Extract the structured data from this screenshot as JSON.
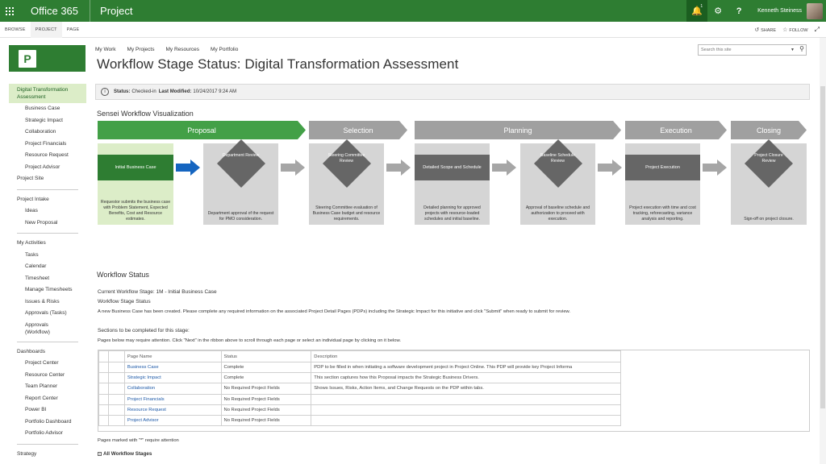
{
  "suite": {
    "brand": "Office 365",
    "app": "Project",
    "notification_count": "1",
    "user_name": "Kenneth Steiness"
  },
  "ribbon": {
    "tabs": [
      "BROWSE",
      "PROJECT",
      "PAGE"
    ],
    "share": "SHARE",
    "follow": "FOLLOW"
  },
  "top_links": [
    "My Work",
    "My Projects",
    "My Resources",
    "My Portfolio"
  ],
  "search": {
    "placeholder": "Search this site"
  },
  "page_title": "Workflow Stage Status: Digital Transformation Assessment",
  "status_bar": {
    "status_label": "Status:",
    "status_value": "Checked-in",
    "modified_label": "Last Modified:",
    "modified_value": "10/24/2017 9:24 AM"
  },
  "left_nav": {
    "project": "Digital Transformation Assessment",
    "project_children": [
      "Business Case",
      "Strategic Impact",
      "Collaboration",
      "Project Financials",
      "Resource Request",
      "Project Advisor"
    ],
    "project_site": "Project Site",
    "intake": "Project Intake",
    "intake_children": [
      "Ideas",
      "New Proposal"
    ],
    "activities": "My Activities",
    "activities_children": [
      "Tasks",
      "Calendar",
      "Timesheet",
      "Manage Timesheets",
      "Issues & Risks",
      "Approvals (Tasks)",
      "Approvals (Workflow)"
    ],
    "dashboards": "Dashboards",
    "dashboards_children": [
      "Project Center",
      "Resource Center",
      "Team Planner",
      "Report Center",
      "Power BI",
      "Portfolio Dashboard",
      "Portfolio Advisor"
    ],
    "strategy": "Strategy"
  },
  "visualization": {
    "title": "Sensei Workflow Visualization",
    "phases": [
      "Proposal",
      "Selection",
      "Planning",
      "Execution",
      "Closing"
    ],
    "steps": [
      {
        "title": "Initial Business Case",
        "desc": "Requestor submits the business case with Problem Statement, Expected Benefits, Cost and Resource estimates."
      },
      {
        "title": "Department Review",
        "desc": "Department approval of the request for PMO consideration."
      },
      {
        "title": "Steering Committee Review",
        "desc": "Steering Committee evaluation of Business Case budget and resource requirements."
      },
      {
        "title": "Detailed Scope and Schedule",
        "desc": "Detailed planning for approved projects with resource-loaded schedules and initial baseline."
      },
      {
        "title": "Baseline Schedule Review",
        "desc": "Approval of baseline schedule and authorization to proceed with execution."
      },
      {
        "title": "Project Execution",
        "desc": "Project execution with time and cost tracking, reforecasting, variance analysis and reporting."
      },
      {
        "title": "Project Closure Review",
        "desc": "Sign-off on project closure."
      }
    ]
  },
  "workflow_status": {
    "title": "Workflow Status",
    "current_stage": "Current Workflow Stage: 1M - Initial Business Case",
    "stage_status_label": "Workflow Stage Status",
    "stage_status_text": "A new Business Case has been created. Please complete any required information on the associated Project Detail Pages (PDPs) including the Strategic Impact for this initiative and click \"Submit\" when ready to submit for review.",
    "sections_label": "Sections to be completed for this stage:",
    "sections_hint": "Pages below may require attention. Click \"Next\" in the ribbon above to scroll through each page or select an individual page by clicking on it below.",
    "table_headers": [
      "Page Name",
      "Status",
      "Description"
    ],
    "table_rows": [
      {
        "page": "Business Case",
        "status": "Complete",
        "desc": "PDP to be filled in when initiating a software development project in Project Online. This PDP will provide key Project Informa"
      },
      {
        "page": "Strategic Impact",
        "status": "Complete",
        "desc": "This section captures how this Proposal impacts the Strategic Business Drivers."
      },
      {
        "page": "Collaboration",
        "status": "No Required Project Fields",
        "desc": "Shows Issues, Risks, Action Items, and Change Requests on the PDP within tabs."
      },
      {
        "page": "Project Financials",
        "status": "No Required Project Fields",
        "desc": ""
      },
      {
        "page": "Resource Request",
        "status": "No Required Project Fields",
        "desc": ""
      },
      {
        "page": "Project Advisor",
        "status": "No Required Project Fields",
        "desc": ""
      }
    ],
    "footer_note": "Pages marked with \"*\" require attention",
    "all_stages": "All Workflow Stages"
  },
  "colors": {
    "brand_green": "#2e7d32",
    "phase_active": "#43a047",
    "phase_inactive": "#a0a0a0",
    "link_blue": "#1e5aa8",
    "current_arrow": "#1565c0"
  }
}
